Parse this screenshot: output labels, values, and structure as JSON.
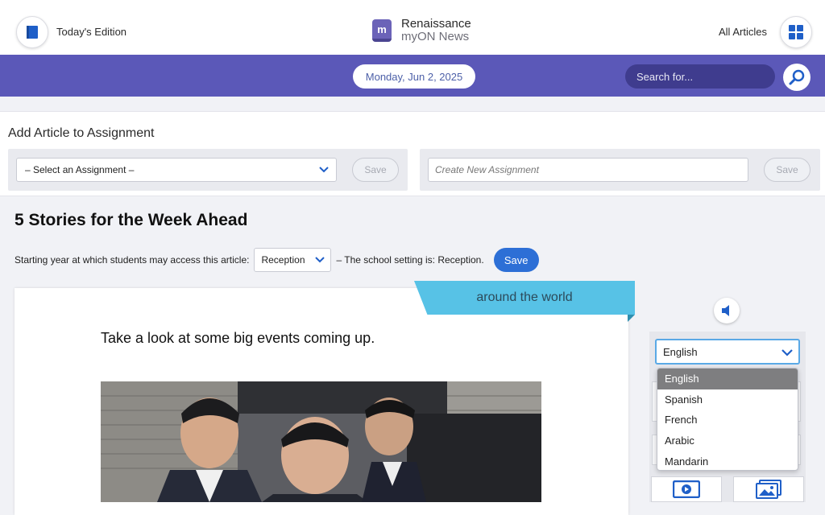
{
  "header": {
    "today_label": "Today's Edition",
    "logo_mark": "m",
    "logo_line1": "Renaissance",
    "logo_line2": "myON News",
    "all_articles_label": "All Articles",
    "icons": {
      "today": "book-icon",
      "all": "grid-icon"
    }
  },
  "navbar": {
    "date": "Monday, Jun 2, 2025",
    "search_placeholder": "Search for...",
    "icons": {
      "search": "magnifier-icon"
    },
    "color": "#5b58b8"
  },
  "assignment": {
    "title": "Add Article to Assignment",
    "select_value": "– Select an Assignment –",
    "save_label": "Save",
    "new_placeholder": "Create New Assignment",
    "new_save_label": "Save"
  },
  "story": {
    "title": "5 Stories for the Week Ahead",
    "access_prefix": "Starting year at which students may access this article:",
    "year_value": "Reception",
    "access_suffix": "– The school setting is: Reception.",
    "save_label": "Save",
    "category_ribbon": "around the world",
    "lead": "Take a look at some big events coming up."
  },
  "tools": {
    "language_value": "English",
    "language_options": [
      "English",
      "Spanish",
      "French",
      "Arabic",
      "Mandarin"
    ],
    "selected_index": 0,
    "icons": {
      "audio": "speaker-icon",
      "video": "video-icon",
      "gallery": "image-gallery-icon"
    },
    "accent": "#2d6fd6",
    "ribbon_color": "#57c2e6"
  }
}
